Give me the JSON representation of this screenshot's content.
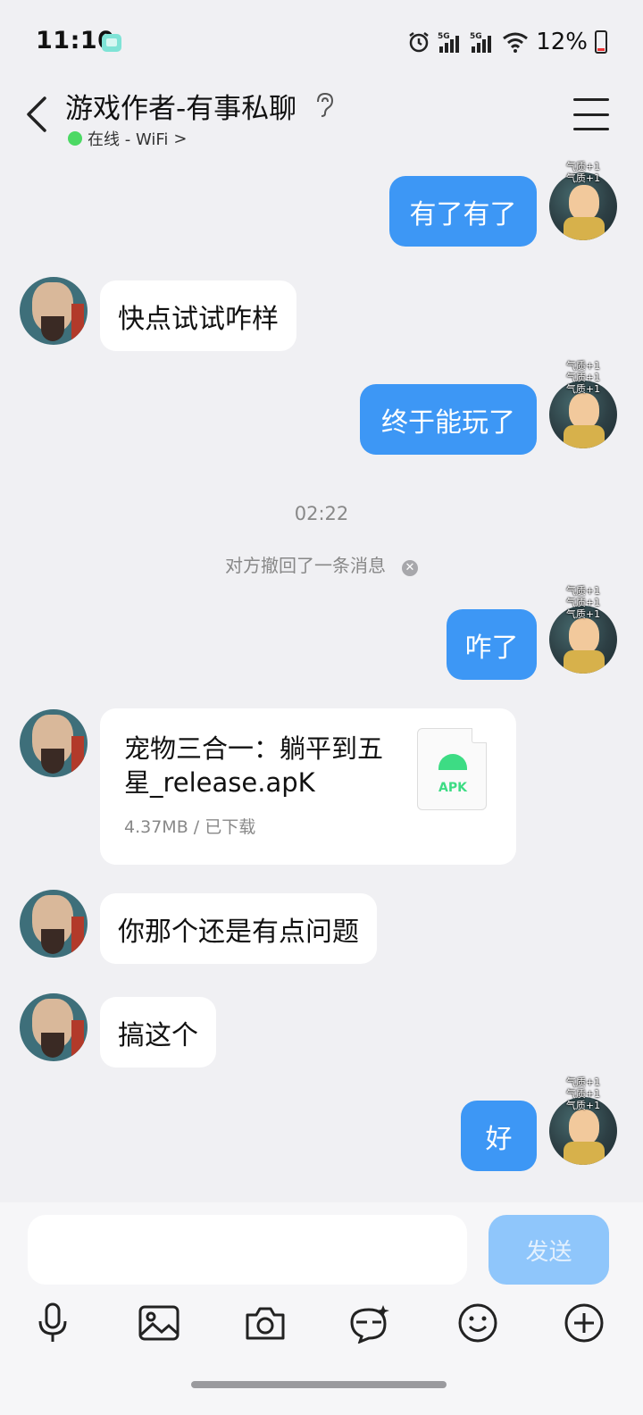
{
  "status_bar": {
    "time": "11:10",
    "battery": "12%",
    "network_1": "5G",
    "network_2": "5G"
  },
  "header": {
    "title": "游戏作者-有事私聊",
    "status": "在线 - WiFi",
    "status_chevron": ">"
  },
  "badges": {
    "self_line1": "气质+1",
    "self_line2": "气质+1",
    "self_line3": "气质+1"
  },
  "messages": [
    {
      "side": "out",
      "text": "有了有了"
    },
    {
      "side": "in",
      "text": "快点试试咋样"
    },
    {
      "side": "out",
      "text": "终于能玩了"
    },
    {
      "side": "out",
      "text": "咋了"
    },
    {
      "side": "in",
      "text": "你那个还是有点问题"
    },
    {
      "side": "in",
      "text": "搞这个"
    },
    {
      "side": "out",
      "text": "好"
    }
  ],
  "system": {
    "timestamp": "02:22",
    "recall": "对方撤回了一条消息"
  },
  "file": {
    "name": "宠物三合一：躺平到五星_release.apK",
    "meta": "4.37MB / 已下载",
    "type": "APK"
  },
  "input": {
    "value": "",
    "send_label": "发送"
  },
  "toolbar": {
    "icons": [
      "microphone-icon",
      "image-icon",
      "camera-icon",
      "sticker-icon",
      "emoji-icon",
      "plus-icon"
    ]
  },
  "colors": {
    "bubble_out": "#3d97f5",
    "bubble_in": "#ffffff",
    "background": "#f0f0f3",
    "send_disabled": "#8fc6fb",
    "online": "#4cd964"
  }
}
